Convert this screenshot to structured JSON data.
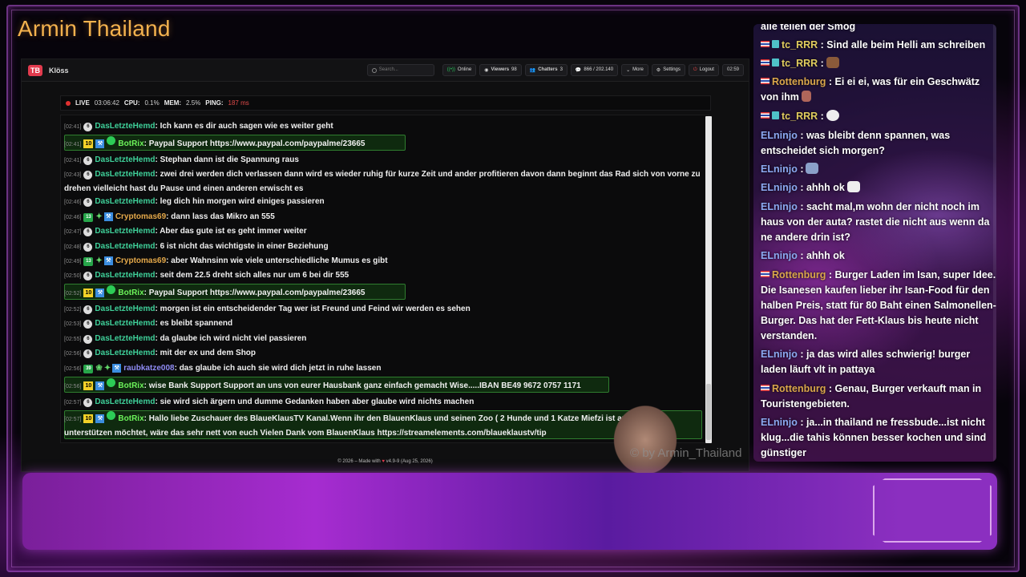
{
  "channel_title": "Armin Thailand",
  "watermark": "© by Armin_Thailand",
  "navbar": {
    "logo": "TB",
    "brand": "Klöss",
    "search_placeholder": "Search...",
    "online": "Online",
    "viewers_label": "Viewers",
    "viewers": "98",
    "chatters_label": "Chatters",
    "chatters": "3",
    "messages": "866 / 202.140",
    "more": "More",
    "settings": "Settings",
    "logout": "Logout",
    "time": "02:59"
  },
  "status": {
    "live": "LIVE",
    "live_time": "03:06:42",
    "cpu_label": "CPU:",
    "cpu": "0.1%",
    "mem_label": "MEM:",
    "mem": "2.5%",
    "ping_label": "PING:",
    "ping": "187 ms"
  },
  "messages": [
    {
      "ts": "[02:41]",
      "user": "DasLetzteHemd",
      "text": "Ich kann es dir auch sagen wie es weiter geht"
    },
    {
      "ts": "[02:41]",
      "user": "BotRix",
      "text": "Paypal Support https://www.paypal.com/paypalme/23665"
    },
    {
      "ts": "[02:41]",
      "user": "DasLetzteHemd",
      "text": "Stephan dann ist die Spannung raus"
    },
    {
      "ts": "[02:43]",
      "user": "DasLetzteHemd",
      "text": "zwei drei werden dich verlassen dann wird es wieder ruhig für kurze Zeit und ander profitieren davon dann beginnt das Rad sich von vorne zu drehen vielleicht hast du Pause und einen anderen erwischt es"
    },
    {
      "ts": "[02:46]",
      "user": "DasLetzteHemd",
      "text": "leg dich hin morgen wird einiges passieren"
    },
    {
      "ts": "[02:46]",
      "user": "Cryptomas69",
      "text": "dann lass das Mikro an 555",
      "sub": "13"
    },
    {
      "ts": "[02:47]",
      "user": "DasLetzteHemd",
      "text": "Aber das gute ist es geht immer weiter"
    },
    {
      "ts": "[02:48]",
      "user": "DasLetzteHemd",
      "text": "6 ist nicht das wichtigste in einer Beziehung"
    },
    {
      "ts": "[02:49]",
      "user": "Cryptomas69",
      "text": "aber Wahnsinn wie viele unterschiedliche Mumus es gibt",
      "sub": "13"
    },
    {
      "ts": "[02:50]",
      "user": "DasLetzteHemd",
      "text": "seit dem 22.5 dreht sich alles nur um 6 bei dir 555"
    },
    {
      "ts": "[02:52]",
      "user": "BotRix",
      "text": "Paypal Support https://www.paypal.com/paypalme/23665"
    },
    {
      "ts": "[02:52]",
      "user": "DasLetzteHemd",
      "text": "morgen ist ein entscheidender Tag wer ist Freund und Feind wir werden es sehen"
    },
    {
      "ts": "[02:53]",
      "user": "DasLetzteHemd",
      "text": "es bleibt spannend"
    },
    {
      "ts": "[02:55]",
      "user": "DasLetzteHemd",
      "text": "da glaube ich wird nicht viel passieren"
    },
    {
      "ts": "[02:56]",
      "user": "DasLetzteHemd",
      "text": "mit der ex und dem Shop"
    },
    {
      "ts": "[02:56]",
      "user": "raubkatze008",
      "text": "das glaube ich auch sie wird dich jetzt in ruhe lassen",
      "sub": "39"
    },
    {
      "ts": "[02:56]",
      "user": "BotRix",
      "text": "wise Bank Support Support an uns von eurer Hausbank ganz einfach gemacht Wise.....IBAN BE49 9672 0757 1171"
    },
    {
      "ts": "[02:57]",
      "user": "DasLetzteHemd",
      "text": "sie wird sich ärgern und dumme Gedanken haben aber glaube wird nichts machen"
    },
    {
      "ts": "[02:57]",
      "user": "BotRix",
      "text": "Hallo liebe Zuschauer des BlaueKlausTV Kanal.Wenn ihr den BlauenKlaus und seinen Zoo ( 2 Hunde und 1 Katze Miefzi ist auf Urlaub ) unterstützen möchtet, wäre das sehr nett von euch Vielen Dank vom BlauenKlaus https://streamelements.com/blaueklaustv/tip"
    }
  ],
  "badge_num": "6",
  "bot_badge": "10",
  "footer": {
    "pre": "© 2026 – Made with",
    "heart": "♥",
    "post": "v4.9-9 (Aug 25, 2026)"
  },
  "right_chat": [
    {
      "user": "",
      "text": "alle teilen der Smog"
    },
    {
      "user": "tc_RRR",
      "text": ": Sind alle beim Helli am schreiben"
    },
    {
      "user": "tc_RRR",
      "text": ":"
    },
    {
      "user": "Rottenburg",
      "text": ": Ei ei ei, was für ein Geschwätz von ihm"
    },
    {
      "user": "tc_RRR",
      "text": ":"
    },
    {
      "user": "ELninjo",
      "text": ": was bleibt denn spannen, was entscheidet sich morgen?"
    },
    {
      "user": "ELninjo",
      "text": ":"
    },
    {
      "user": "ELninjo",
      "text": ": ahhh ok"
    },
    {
      "user": "ELninjo",
      "text": ": sacht mal,m wohn der nicht noch im haus von der auta? rastet die nicht aus wenn da ne andere drin ist?"
    },
    {
      "user": "ELninjo",
      "text": ": ahhh ok"
    },
    {
      "user": "Rottenburg",
      "text": ": Burger Laden im Isan, super Idee. Die Isanesen kaufen lieber ihr Isan-Food für den halben Preis, statt für 80 Baht einen Salmonellen-Burger. Das hat der Fett-Klaus bis heute nicht verstanden."
    },
    {
      "user": "ELninjo",
      "text": ": ja das wird alles schwierig! burger laden läuft vlt in pattaya"
    },
    {
      "user": "Rottenburg",
      "text": ": Genau, Burger verkauft man in Touristengebieten."
    },
    {
      "user": "ELninjo",
      "text": ": ja...in thailand ne fressbude...ist nicht klug...die tahis können besser kochen und sind günstiger"
    }
  ]
}
